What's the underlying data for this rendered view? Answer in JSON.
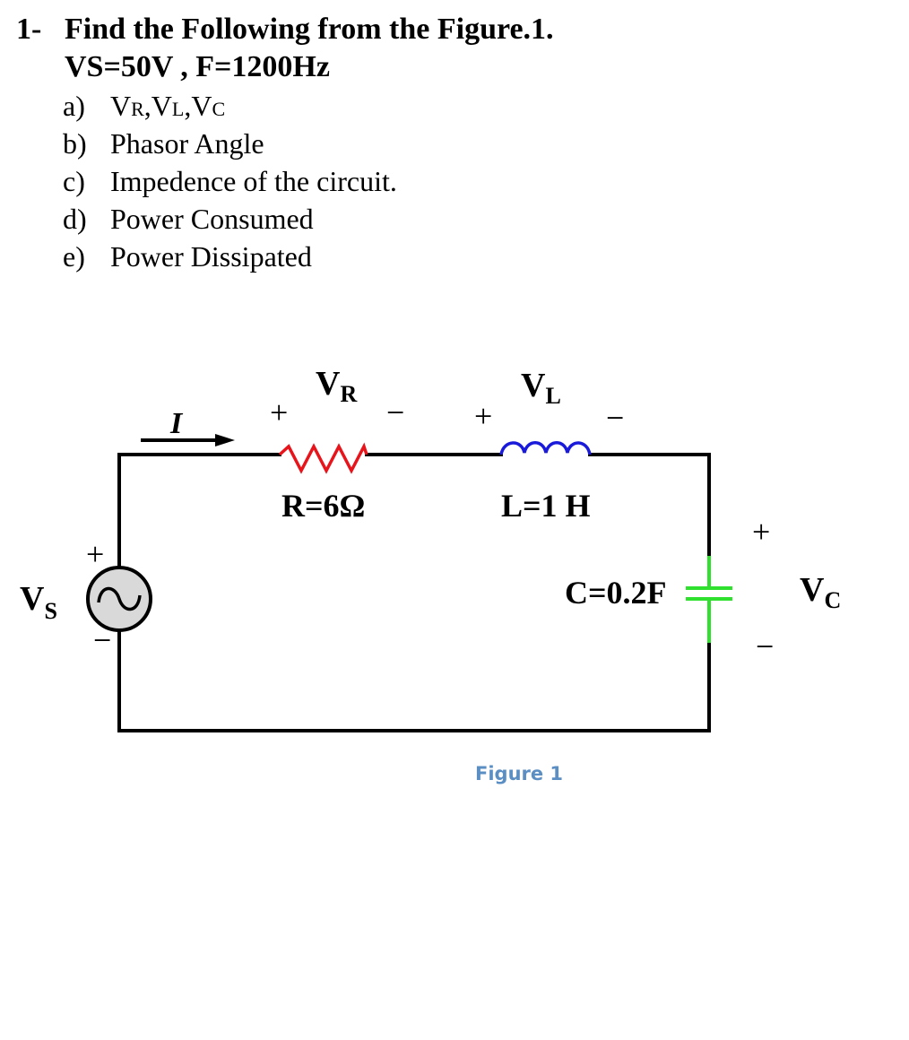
{
  "question": {
    "number": "1-",
    "title": "Find the Following from the Figure.1.",
    "given": "VS=50V , F=1200Hz",
    "items": [
      {
        "label": "a)",
        "text": "",
        "parts": [
          {
            "main": "V",
            "sub": "R"
          },
          {
            "main": ",V",
            "sub": "L"
          },
          {
            "main": ",V",
            "sub": "C"
          }
        ]
      },
      {
        "label": "b)",
        "text": "Phasor Angle"
      },
      {
        "label": "c)",
        "text": "Impedence of the circuit."
      },
      {
        "label": "d)",
        "text": "Power Consumed"
      },
      {
        "label": "e)",
        "text": "Power Dissipated"
      }
    ]
  },
  "circuit": {
    "current_label": "I",
    "source": {
      "label_main": "V",
      "label_sub": "S",
      "plus": "+",
      "minus": "−"
    },
    "resistor": {
      "label_main": "V",
      "label_sub": "R",
      "value": "R=6Ω",
      "plus": "+",
      "minus": "−",
      "color": "#e8141b"
    },
    "inductor": {
      "label_main": "V",
      "label_sub": "L",
      "value": "L=1 H",
      "plus": "+",
      "minus": "−",
      "color": "#1a1adb"
    },
    "capacitor": {
      "label_main": "V",
      "label_sub": "C",
      "value": "C=0.2F",
      "plus": "+",
      "minus": "−",
      "color": "#2fe02f"
    },
    "caption": "Figure 1"
  }
}
